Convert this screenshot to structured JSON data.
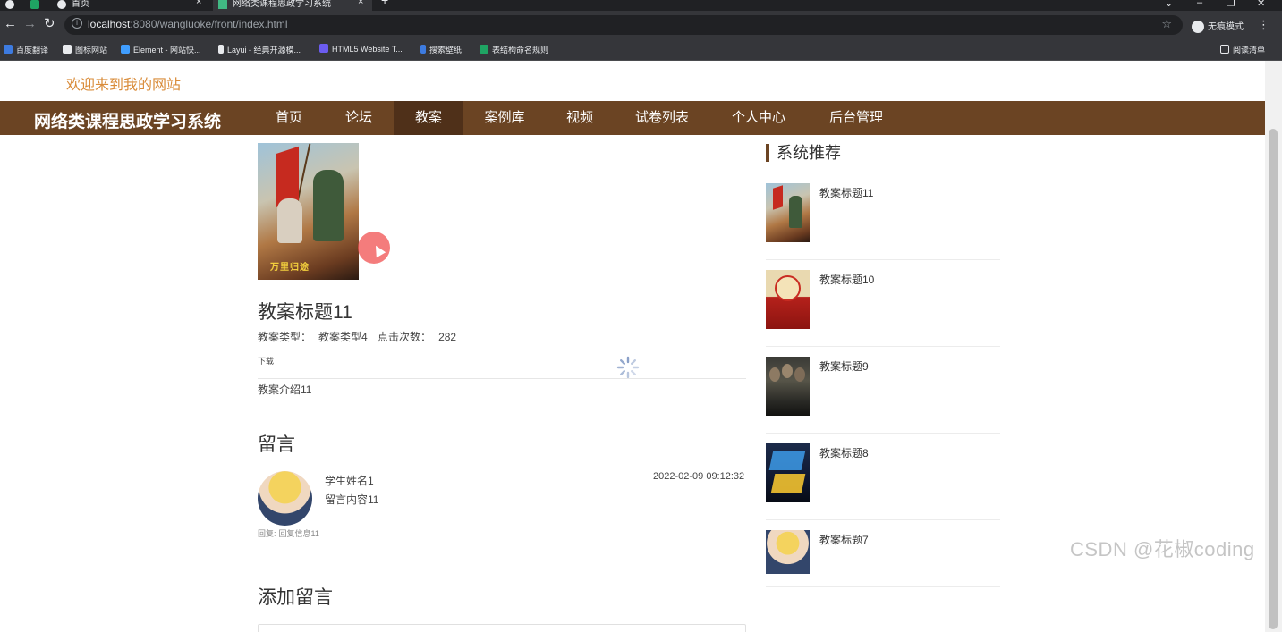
{
  "browser": {
    "tabs": [
      {
        "title": ""
      },
      {
        "title": ""
      },
      {
        "title": "首页"
      },
      {
        "title": "网络类课程思政学习系统"
      }
    ],
    "url": {
      "host": "localhost",
      "rest": ":8080/wangluoke/front/index.html"
    },
    "incognito_label": "无痕模式",
    "reading_list_label": "阅读清单",
    "bookmarks": [
      "百度翻译",
      "图标网站",
      "Element - 网站快...",
      "Layui - 经典开源模...",
      "HTML5 Website T...",
      "搜索壁纸",
      "表结构命名规则"
    ]
  },
  "header": {
    "welcome": "欢迎来到我的网站",
    "site_title": "网络类课程思政学习系统",
    "nav": [
      "首页",
      "论坛",
      "教案",
      "案例库",
      "视频",
      "试卷列表",
      "个人中心",
      "后台管理"
    ],
    "active_nav": "教案"
  },
  "detail": {
    "poster_caption": "万里归途",
    "title": "教案标题11",
    "type_label": "教案类型：",
    "type_value": "教案类型4",
    "clicks_label": "点击次数：",
    "clicks_value": "282",
    "download": "下载",
    "intro": "教案介绍11"
  },
  "comments": {
    "section_title": "留言",
    "items": [
      {
        "name": "学生姓名1",
        "content": "留言内容11",
        "time": "2022-02-09 09:12:32",
        "reply_label": "回复:",
        "reply": "回复信息11"
      }
    ]
  },
  "add_comment": {
    "title": "添加留言"
  },
  "sidebar": {
    "title": "系统推荐",
    "items": [
      "教案标题11",
      "教案标题10",
      "教案标题9",
      "教案标题8",
      "教案标题7"
    ]
  },
  "watermark": "CSDN @花椒coding",
  "colors": {
    "nav_bg": "#6b4423",
    "nav_active": "#4f3019",
    "welcome": "#d98c3a"
  }
}
